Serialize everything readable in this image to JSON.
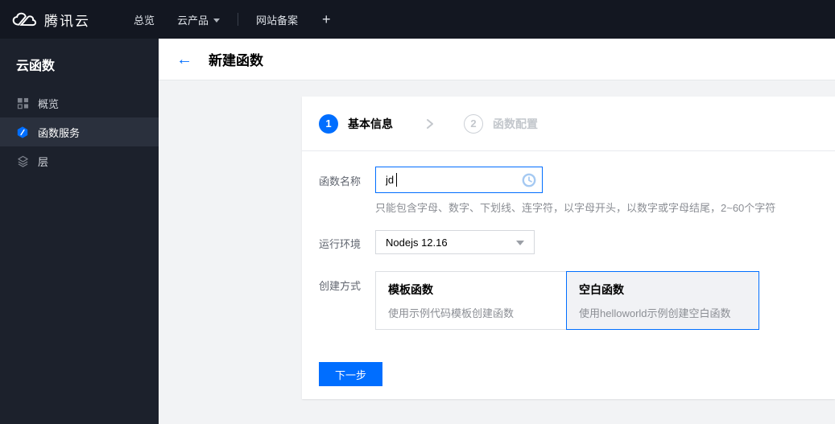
{
  "topbar": {
    "brand": "腾讯云",
    "nav": [
      {
        "label": "总览"
      },
      {
        "label": "云产品"
      },
      {
        "label": "网站备案"
      }
    ],
    "plus_label": "+"
  },
  "sidebar": {
    "title": "云函数",
    "items": [
      {
        "label": "概览",
        "icon": "grid-icon",
        "active": false
      },
      {
        "label": "函数服务",
        "icon": "scf-hexagon-icon",
        "active": true
      },
      {
        "label": "层",
        "icon": "layers-icon",
        "active": false
      }
    ]
  },
  "header": {
    "back": "←",
    "title": "新建函数"
  },
  "wizard": {
    "steps": [
      {
        "num": "1",
        "label": "基本信息",
        "state": "active"
      },
      {
        "num": "2",
        "label": "函数配置",
        "state": "inactive"
      }
    ]
  },
  "form": {
    "name_label": "函数名称",
    "name_value": "jd",
    "name_hint": "只能包含字母、数字、下划线、连字符，以字母开头，以数字或字母结尾，2~60个字符",
    "runtime_label": "运行环境",
    "runtime_value": "Nodejs 12.16",
    "method_label": "创建方式",
    "methods": [
      {
        "title": "模板函数",
        "desc": "使用示例代码模板创建函数",
        "selected": false
      },
      {
        "title": "空白函数",
        "desc": "使用helloworld示例创建空白函数",
        "selected": true
      }
    ],
    "next_button": "下一步"
  },
  "colors": {
    "accent": "#006eff",
    "topbar_bg": "#131721",
    "sidebar_bg": "#1c212c",
    "sidebar_active_bg": "#2a303d",
    "content_bg": "#f2f3f5",
    "selected_card_bg": "#f1f2f5"
  }
}
